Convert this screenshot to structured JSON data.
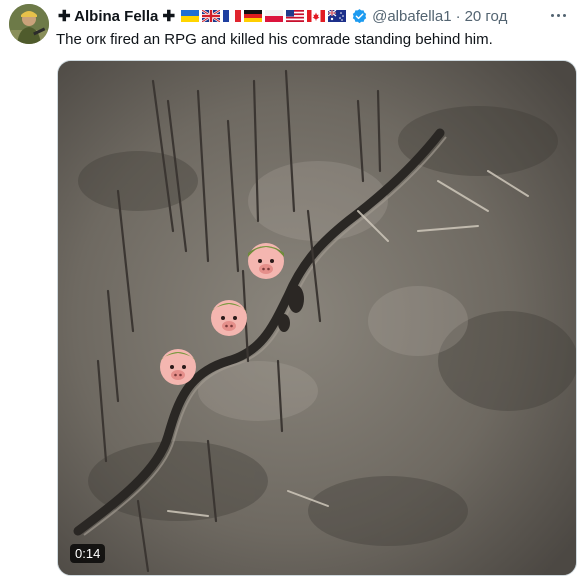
{
  "tweet": {
    "display_name": "✚ Albina Fella ✚",
    "flags": [
      "ukraine-flag",
      "uk-flag",
      "france-flag",
      "germany-flag",
      "poland-flag",
      "usa-flag",
      "canada-flag",
      "australia-flag"
    ],
    "handle": "@albafella1",
    "separator": "·",
    "time": "20 год",
    "text": "The orк fired an RPG and killed his comrade standing behind him.",
    "media": {
      "duration": "0:14",
      "overlay_icons": [
        "pig-soldier-icon",
        "pig-soldier-icon",
        "pig-soldier-icon"
      ]
    }
  },
  "colors": {
    "text": "#0f1419",
    "secondary": "#536471",
    "verified": "#1d9bf0",
    "border": "#cfd9de"
  }
}
